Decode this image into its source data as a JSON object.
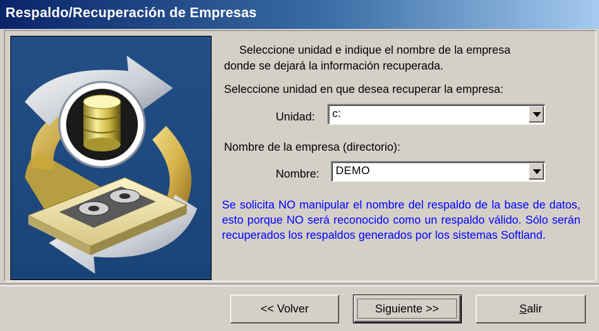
{
  "window": {
    "title": "Respaldo/Recuperación de Empresas"
  },
  "instructions": {
    "line1": "Seleccione  unidad e indique el nombre de la empresa",
    "line2": "donde se dejará la información recuperada.",
    "select_drive_prompt": "Seleccione unidad en que desea recuperar la empresa:",
    "company_prompt": "Nombre de la empresa (directorio):"
  },
  "fields": {
    "unidad_label": "Unidad:",
    "unidad_value": "c:",
    "nombre_label": "Nombre:",
    "nombre_value": "DEMO"
  },
  "notice": "Se solicita NO manipular el nombre del respaldo de la base de datos, esto porque NO será reconocido como un respaldo válido.  Sólo serán recuperados los respaldos generados por los sistemas Softland.",
  "buttons": {
    "back": "<< Volver",
    "next": "Siguiente >>",
    "exit_rest": "alir",
    "exit_accel": "S"
  },
  "colors": {
    "title_gradient_start": "#0a246a",
    "title_gradient_end": "#a6caf0",
    "dialog_bg": "#d4d0c8",
    "notice_text": "#0000ff",
    "illustration_bg": "#1e4d84"
  },
  "icons": {
    "illustration": "backup-restore-database-tape-icon",
    "dropdown": "chevron-down-icon"
  }
}
